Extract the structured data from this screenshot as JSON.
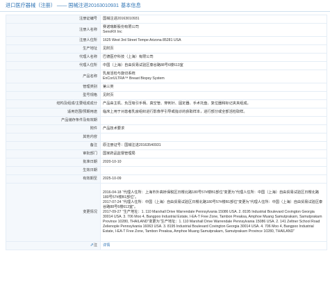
{
  "breadcrumb": {
    "parent": "进口医疗器械（注册）",
    "separator": "——",
    "current": "国械注进20163010931",
    "suffix": "基本信息"
  },
  "fields": [
    {
      "label": "注册证编号",
      "value": "国械注进20163010931"
    },
    {
      "label": "注册人名称",
      "value": "赛诺瑞斯股份有限公司\nSenoRX Inc"
    },
    {
      "label": "注册人住所",
      "value": "1625 West 3rd Street Tempe Arizona 85281 USA"
    },
    {
      "label": "生产地址",
      "value": "见附页"
    },
    {
      "label": "代理人名称",
      "value": "巴德医疗科技（上海）有限公司"
    },
    {
      "label": "代理人住所",
      "value": "中国（上海）自由贸易试验区泰谷路88号6楼613室"
    },
    {
      "label": "产品名称",
      "value": "乳房活检与旋切系统\nEnCorULTRA™ Breast Biopsy System"
    },
    {
      "label": "管理类别",
      "value": "第三类"
    },
    {
      "label": "型号规格",
      "value": "见附页"
    },
    {
      "label": "结构及组成/主要组成成分",
      "value": "产品由主机、负压吸引手柄、真空管、穿刺针、固定器、手术托盘、复位器和标记夹夹组成。"
    },
    {
      "label": "适用范围/预期用途",
      "value": "临床上用于对患者乳房组织进行影像学引导或指诊的获取样本，进行部分或全部活检取样。"
    },
    {
      "label": "产品储存条件及有效期",
      "value": ""
    },
    {
      "label": "附件",
      "value": "产品技术要求"
    },
    {
      "label": "其他内容",
      "value": ""
    },
    {
      "label": "备注",
      "value": "原注册证号：国械注进20163540931"
    },
    {
      "label": "审批部门",
      "value": "国家药品监督管理局"
    },
    {
      "label": "批准日期",
      "value": "2020-10-10"
    },
    {
      "label": "生效日期",
      "value": ""
    },
    {
      "label": "有效期至",
      "value": "2025-10-09"
    },
    {
      "label": "变更情况",
      "value": "2016-04-18 “代理人住所：上海市外高桥保税区日樱北路180号57#楼B1部位”变更为“代理人住所：中国（上海）自由贸易试验区日樱北路180号57#楼B1部位”。\n2017-07-24 “代理人住所：中国（上海）自由贸易试验区日樱北路180号57#楼B1部位”变更为“代理人住所：中国（上海）自由贸易试验区泰谷路88号6楼613室”。\n2017-09-27 “生产地址：1. 110 Marshall Drive Warrendale Pennsylvania 15086 USA. 2. 8195 Industrial Boulevard Covington Georgia 30014 USA. 3. 706 Moo 4, Bangpoo Industrial Estate, I-EA-T Free Zone, Tambon Preaksa, Amphoe Muang Samutprakarn, Samutprakarn Province 10280, THAILAND”变更为“生产地址：1. 110 Marshall Drive Warrendale Pennsylvania 15086 USA. 2. 141 Zeltner School Road Zelienople Pennsylvania 16063 USA. 3. 8195 Industrial Boulevard Covington Georgia 30014 USA. 4. 706 Moo 4, Bangpoo Industrial Estate, I-EA-T Free Zone, Tambon Preaksa, Amphoe Muang Samutprakarn, Samutprakarn Province 10280, THAILAND”"
    }
  ],
  "footer": {
    "label": "注",
    "link": "详情"
  }
}
